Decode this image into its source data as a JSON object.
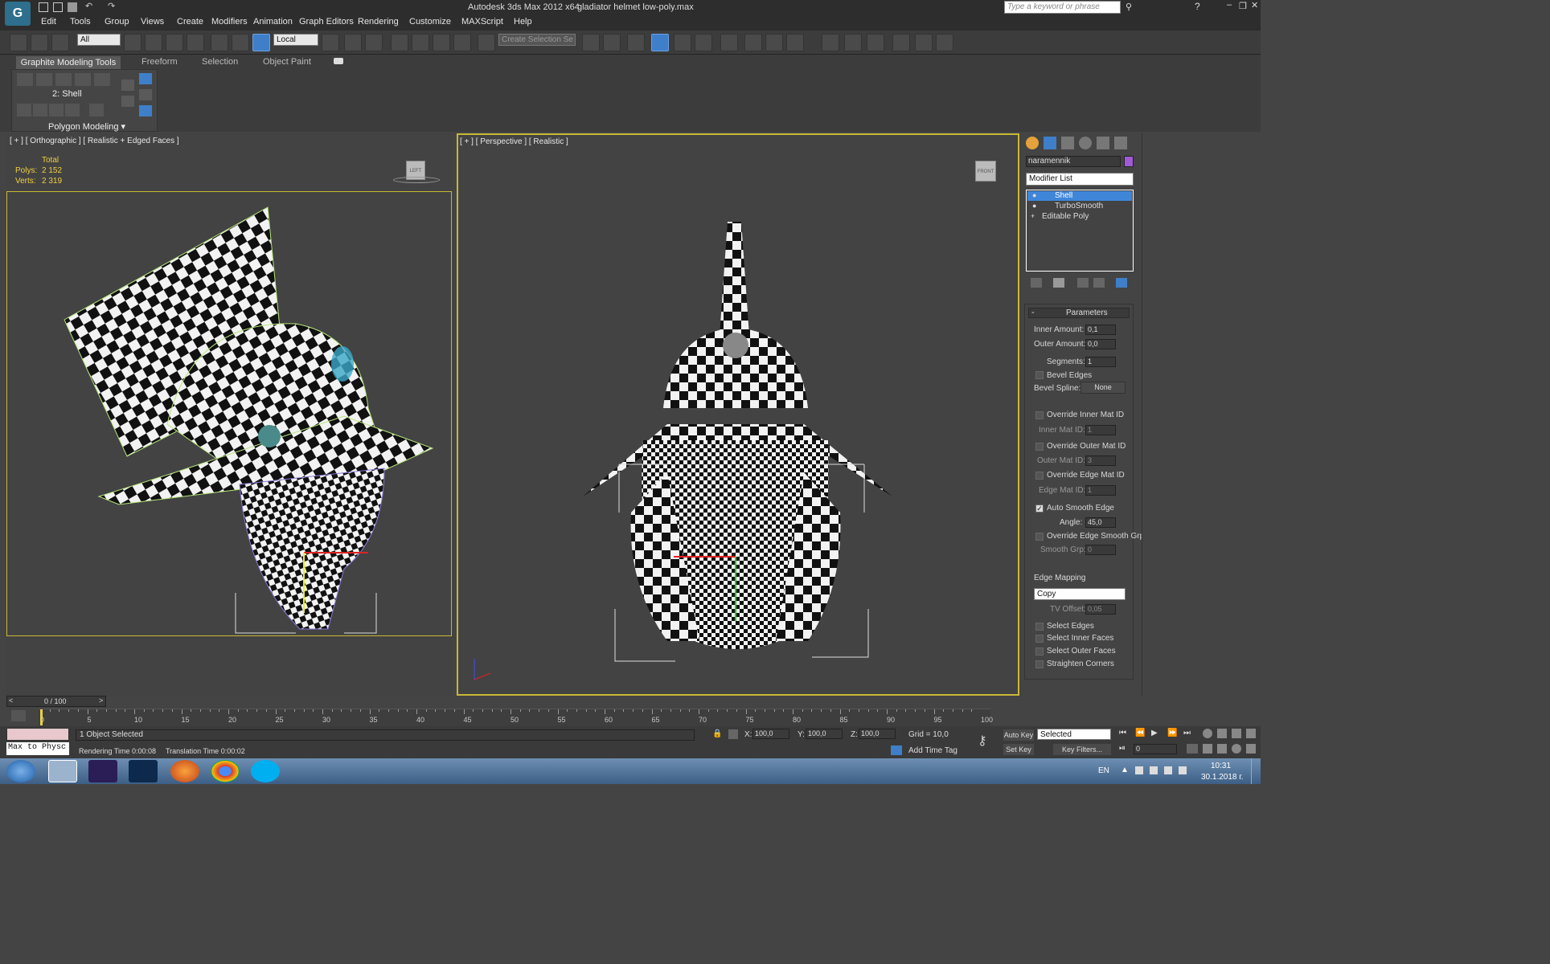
{
  "window": {
    "app_title": "Autodesk 3ds Max  2012 x64",
    "file_title": "gladiator helmet low-poly.max",
    "search_placeholder": "Type a keyword or phrase"
  },
  "menu": [
    "Edit",
    "Tools",
    "Group",
    "Views",
    "Create",
    "Modifiers",
    "Animation",
    "Graph Editors",
    "Rendering",
    "Customize",
    "MAXScript",
    "Help"
  ],
  "toolbar": {
    "filter_value": "All",
    "ref_coord": "Local",
    "selection_set_placeholder": "Create Selection Se"
  },
  "ribbon": {
    "tabs": [
      "Graphite Modeling Tools",
      "Freeform",
      "Selection",
      "Object Paint"
    ],
    "stack_label": "2: Shell",
    "panel_label": "Polygon Modeling"
  },
  "viewport_left": {
    "label": "[ + ] [ Orthographic ] [ Realistic + Edged Faces ]",
    "stats_header": "Total",
    "polys_label": "Polys:",
    "polys_value": "2 152",
    "verts_label": "Verts:",
    "verts_value": "2 319",
    "viewcube_label": "LEFT"
  },
  "viewport_right": {
    "label": "[ + ] [ Perspective ] [ Realistic ]",
    "viewcube_label": "FRONT"
  },
  "command_panel": {
    "object_name": "naramennik",
    "object_color": "#a259d6",
    "modifier_list_label": "Modifier List",
    "stack": [
      {
        "label": "Shell",
        "selected": true
      },
      {
        "label": "TurboSmooth",
        "selected": false
      },
      {
        "label": "Editable Poly",
        "selected": false
      }
    ],
    "rollout_title": "Parameters",
    "inner_amount_label": "Inner Amount:",
    "inner_amount": "0,1",
    "outer_amount_label": "Outer Amount:",
    "outer_amount": "0,0",
    "segments_label": "Segments:",
    "segments": "1",
    "bevel_edges_label": "Bevel Edges",
    "bevel_spline_label": "Bevel Spline:",
    "bevel_spline_value": "None",
    "override_inner_label": "Override Inner Mat ID",
    "inner_mat_label": "Inner Mat ID:",
    "inner_mat_value": "1",
    "override_outer_label": "Override Outer Mat ID",
    "outer_mat_label": "Outer Mat ID:",
    "outer_mat_value": "3",
    "override_edge_label": "Override Edge Mat ID",
    "edge_mat_label": "Edge Mat ID:",
    "edge_mat_value": "1",
    "auto_smooth_label": "Auto Smooth Edge",
    "angle_label": "Angle:",
    "angle_value": "45,0",
    "override_smooth_label": "Override Edge Smooth Grp",
    "smooth_grp_label": "Smooth Grp:",
    "smooth_grp_value": "0",
    "edge_mapping_label": "Edge Mapping",
    "edge_mapping_value": "Copy",
    "tv_offset_label": "TV Offset:",
    "tv_offset_value": "0,05",
    "select_edges_label": "Select Edges",
    "select_inner_label": "Select Inner Faces",
    "select_outer_label": "Select Outer Faces",
    "straighten_label": "Straighten Corners"
  },
  "timeline": {
    "frame_display": "0 / 100",
    "ticks": [
      "0",
      "5",
      "10",
      "15",
      "20",
      "25",
      "30",
      "35",
      "40",
      "45",
      "50",
      "55",
      "60",
      "65",
      "70",
      "75",
      "80",
      "85",
      "90",
      "95",
      "100"
    ]
  },
  "status": {
    "selection": "1 Object Selected",
    "render_time": "Rendering Time  0:00:08",
    "translation_time": "Translation Time  0:00:02",
    "maxscript": "Max to Physc",
    "x_label": "X:",
    "x_value": "100,0",
    "y_label": "Y:",
    "y_value": "100,0",
    "z_label": "Z:",
    "z_value": "100,0",
    "grid": "Grid = 10,0",
    "add_time_tag": "Add Time Tag",
    "auto_key": "Auto Key",
    "set_key": "Set Key",
    "key_mode": "Selected",
    "key_filters": "Key Filters...",
    "frame_field": "0"
  },
  "taskbar": {
    "lang": "EN",
    "time": "10:31",
    "date": "30.1.2018 г."
  }
}
